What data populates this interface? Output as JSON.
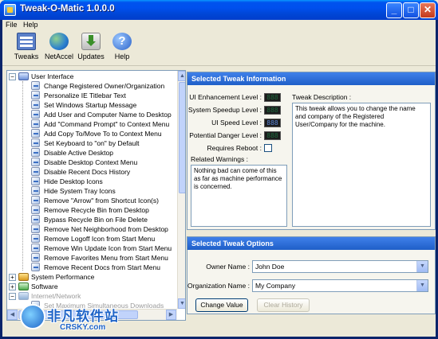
{
  "window": {
    "title": "Tweak-O-Matic 1.0.0.0"
  },
  "menu": [
    {
      "label": "File",
      "key": "F"
    },
    {
      "label": "Help",
      "key": "H"
    }
  ],
  "toolbar": [
    {
      "label": "Tweaks",
      "icon": "tweaks-icon"
    },
    {
      "label": "NetAccel",
      "icon": "netaccel-icon"
    },
    {
      "label": "Updates",
      "icon": "updates-icon"
    },
    {
      "label": "Help",
      "icon": "help-icon"
    }
  ],
  "tree": {
    "root": "User Interface",
    "items": [
      "Change Registered Owner/Organization",
      "Personalize IE Titlebar Text",
      "Set Windows Startup Message",
      "Add User and Computer Name to Desktop",
      "Add \"Command Prompt\" to Context Menu",
      "Add Copy To/Move To to Context Menu",
      "Set Keyboard to \"on\" by Default",
      "Disable Active Desktop",
      "Disable Desktop Context Menu",
      "Disable Recent Docs History",
      "Hide Desktop Icons",
      "Hide System Tray Icons",
      "Remove \"Arrow\" from Shortcut Icon(s)",
      "Remove Recycle Bin from Desktop",
      "Bypass Recycle Bin on File Delete",
      "Remove Net Neighborhood from Desktop",
      "Remove Logoff Icon from Start Menu",
      "Remove Win Update Icon from Start Menu",
      "Remove Favorites Menu from Start Menu",
      "Remove Recent Docs from Start Menu"
    ],
    "groups": [
      "System Performance",
      "Software",
      "Internet/Network"
    ],
    "partial_item": "Set Maximum Simultaneous Downloads"
  },
  "info_panel": {
    "header": "Selected Tweak Information",
    "fields": [
      {
        "label": "UI Enhancement Level :",
        "value": "888"
      },
      {
        "label": "System Speedup Level :",
        "value": "888"
      },
      {
        "label": "UI Speed Level :",
        "value": "888"
      },
      {
        "label": "Potential Danger Level :",
        "value": "888"
      }
    ],
    "reboot_label": "Requires Reboot :",
    "warnings_label": "Related Warnings :",
    "warnings_text": "Nothing bad can come of this as far as machine performance is concerned.",
    "description_label": "Tweak Description :",
    "description_text": "This tweak allows you to change the name and company of the Registered User/Company for the machine."
  },
  "options_panel": {
    "header": "Selected Tweak Options",
    "owner_label": "Owner Name :",
    "owner_value": "John Doe",
    "org_label": "Organization Name :",
    "org_value": "My Company",
    "change_button": "Change Value",
    "clear_button": "Clear History"
  },
  "watermark": {
    "brand": "非凡软件站",
    "sub": "CRSKY.com"
  }
}
